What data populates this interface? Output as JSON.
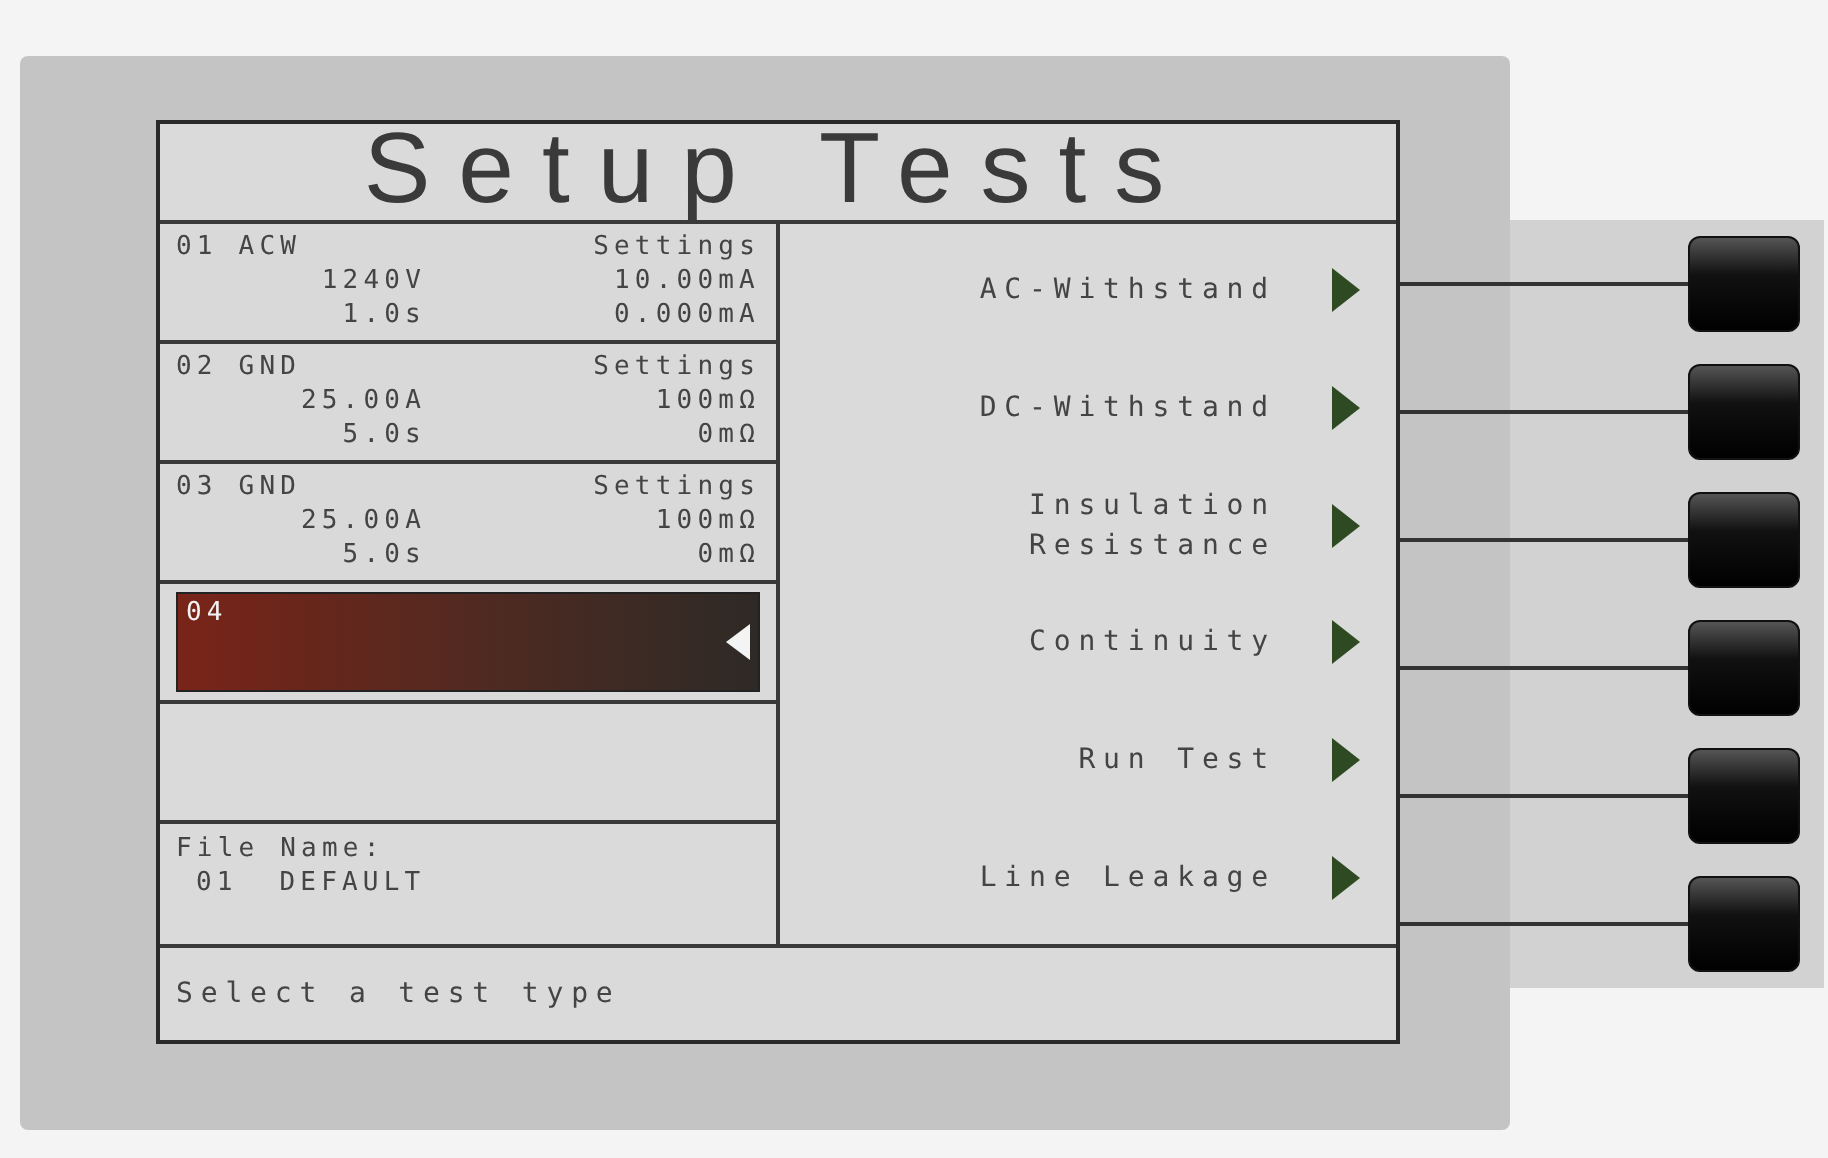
{
  "screen": {
    "title": "Setup Tests",
    "slots": [
      {
        "kind": "test",
        "number": "01",
        "type": "ACW",
        "heading": "Settings",
        "selected": false,
        "lines": [
          [
            "1240V",
            "10.00mA"
          ],
          [
            "1.0s",
            "0.000mA"
          ]
        ]
      },
      {
        "kind": "test",
        "number": "02",
        "type": "GND",
        "heading": "Settings",
        "selected": false,
        "lines": [
          [
            "25.00A",
            "100mΩ"
          ],
          [
            "5.0s",
            "0mΩ"
          ]
        ]
      },
      {
        "kind": "test",
        "number": "03",
        "type": "GND",
        "heading": "Settings",
        "selected": false,
        "lines": [
          [
            "25.00A",
            "100mΩ"
          ],
          [
            "5.0s",
            "0mΩ"
          ]
        ]
      },
      {
        "kind": "test",
        "number": "04",
        "selected": true
      },
      {
        "kind": "empty"
      }
    ],
    "file": {
      "label": "File Name:",
      "number": "01",
      "name": "DEFAULT"
    },
    "menu": [
      {
        "label": [
          "AC-Withstand"
        ]
      },
      {
        "label": [
          "DC-Withstand"
        ]
      },
      {
        "label": [
          "Insulation",
          "Resistance"
        ]
      },
      {
        "label": [
          "Continuity"
        ]
      },
      {
        "label": [
          "Run Test"
        ]
      },
      {
        "label": [
          "Line Leakage"
        ]
      }
    ],
    "status_bar": "Select a test type"
  }
}
